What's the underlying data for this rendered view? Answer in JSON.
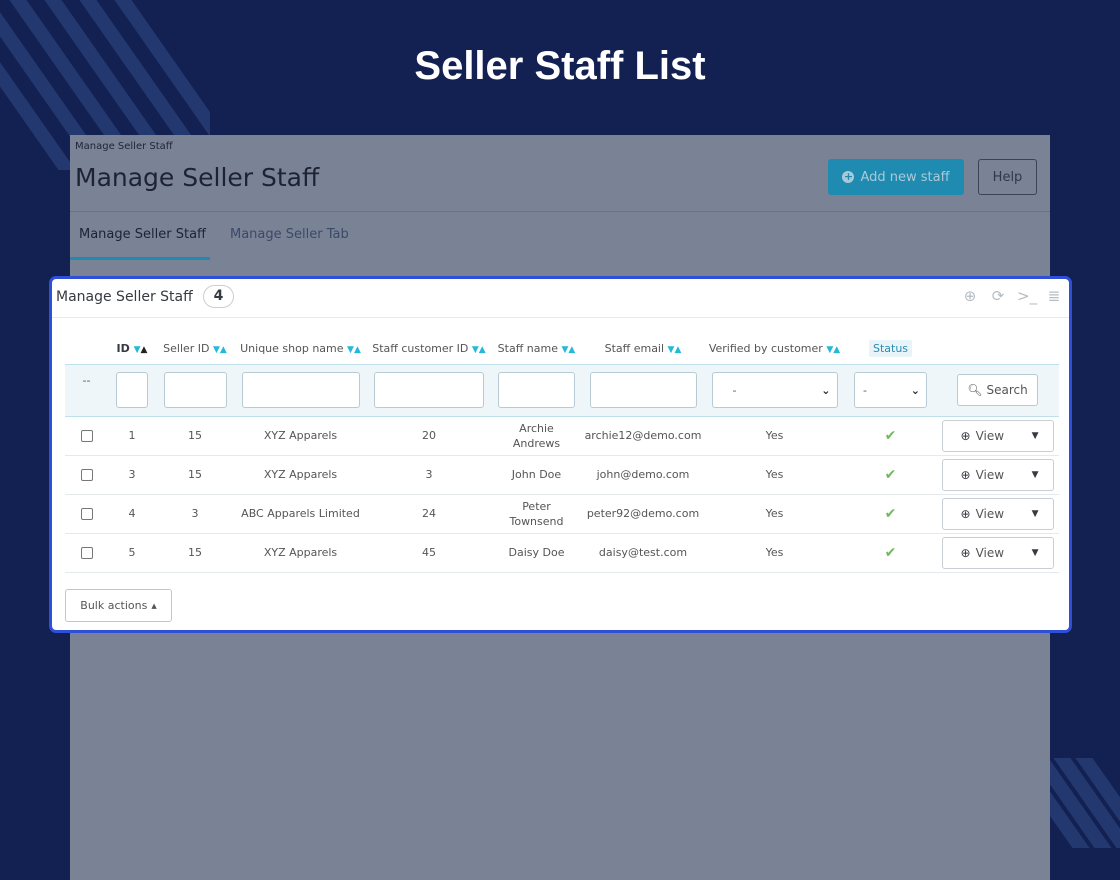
{
  "headline": "Seller Staff List",
  "admin": {
    "breadcrumb": "Manage Seller Staff",
    "page_title": "Manage Seller Staff",
    "add_button": "Add new staff",
    "help_button": "Help",
    "tabs": [
      "Manage Seller Staff",
      "Manage Seller Tab"
    ]
  },
  "panel": {
    "title": "Manage Seller Staff",
    "count": "4",
    "columns": [
      "ID",
      "Seller ID",
      "Unique shop name",
      "Staff customer ID",
      "Staff name",
      "Staff email",
      "Verified by customer",
      "Status"
    ],
    "filter": {
      "reset_label": "--",
      "verified_select": "-",
      "status_select": "-",
      "search_button": "Search"
    },
    "rows": [
      {
        "id": "1",
        "seller_id": "15",
        "shop": "XYZ Apparels",
        "customer_id": "20",
        "name": "Archie Andrews",
        "email": "archie12@demo.com",
        "verified": "Yes",
        "action": "View"
      },
      {
        "id": "3",
        "seller_id": "15",
        "shop": "XYZ Apparels",
        "customer_id": "3",
        "name": "John Doe",
        "email": "john@demo.com",
        "verified": "Yes",
        "action": "View"
      },
      {
        "id": "4",
        "seller_id": "3",
        "shop": "ABC Apparels Limited",
        "customer_id": "24",
        "name": "Peter Townsend",
        "email": "peter92@demo.com",
        "verified": "Yes",
        "action": "View"
      },
      {
        "id": "5",
        "seller_id": "15",
        "shop": "XYZ Apparels",
        "customer_id": "45",
        "name": "Daisy Doe",
        "email": "daisy@test.com",
        "verified": "Yes",
        "action": "View"
      }
    ],
    "bulk_actions": "Bulk actions"
  },
  "colors": {
    "background": "#132052",
    "accent": "#25b9d7",
    "panel_border": "#2f4fd8",
    "status_ok": "#71b85c"
  }
}
